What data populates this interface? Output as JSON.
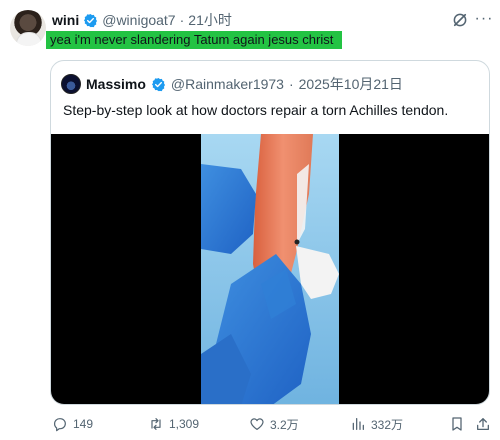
{
  "tweet": {
    "author_name": "wini",
    "handle": "@winigoat7",
    "separator": "·",
    "time": "21小时",
    "text": "yea i'm never slandering Tatum again jesus christ",
    "highlight_color": "#23c343"
  },
  "quoted": {
    "author_name": "Massimo",
    "handle": "@Rainmaker1973",
    "separator": "·",
    "date": "2025年10月21日",
    "text": "Step-by-step look at how doctors repair a torn Achilles tendon."
  },
  "actions": {
    "replies": "149",
    "reposts": "1,309",
    "likes": "3.2万",
    "views": "332万"
  },
  "colors": {
    "verified": "#1d9bf0",
    "muted": "#536471",
    "border": "#cfd9de"
  },
  "icons": [
    "grok-icon",
    "more-icon",
    "verified-icon",
    "reply-icon",
    "repost-icon",
    "like-icon",
    "views-icon",
    "bookmark-icon",
    "share-icon"
  ]
}
